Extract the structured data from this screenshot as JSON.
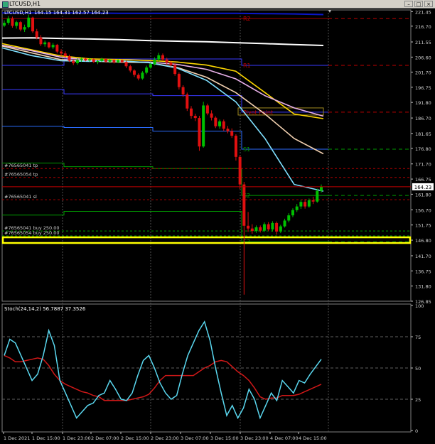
{
  "window": {
    "title": "LTCUSD,H1",
    "buttons": [
      "–",
      "□",
      "×"
    ]
  },
  "chart_header": {
    "symbol": "LTCUSD,H1",
    "ohlc": "164.15 164.31 162.57 164.23"
  },
  "colors": {
    "background": "#000000",
    "bull": "#00c000",
    "bear": "#e01010",
    "grid": "#404040",
    "current_price": "#c00000",
    "order_line": "#ffff00"
  },
  "chart_data": [
    {
      "type": "line",
      "title": "LTCUSD,H1",
      "subtitle": "164.15 164.31 162.57 164.23",
      "y_ticks": [
        221.45,
        216.7,
        211.55,
        206.6,
        201.7,
        196.75,
        191.8,
        186.7,
        181.65,
        176.8,
        171.7,
        166.75,
        161.8,
        156.7,
        151.75,
        146.8,
        141.7,
        136.75,
        131.8,
        126.85
      ],
      "ylim": [
        126.85,
        222.0
      ],
      "x_ticks": [
        "1 Dec 2021",
        "1 Dec 15:00",
        "1 Dec 23:00",
        "2 Dec 07:00",
        "2 Dec 15:00",
        "2 Dec 23:00",
        "3 Dec 07:00",
        "3 Dec 15:00",
        "3 Dec 23:00",
        "4 Dec 07:00",
        "4 Dec 15:00"
      ],
      "current_price": 164.23,
      "highlighted_price": 146.8,
      "candles": [
        [
          216.9,
          218.6,
          216.4,
          217.8
        ],
        [
          217.8,
          220.0,
          217.2,
          219.2
        ],
        [
          219.2,
          219.8,
          216.2,
          216.8
        ],
        [
          216.8,
          218.5,
          215.9,
          218.0
        ],
        [
          218.0,
          218.4,
          215.0,
          215.6
        ],
        [
          215.6,
          217.2,
          214.8,
          216.4
        ],
        [
          216.4,
          220.5,
          216.0,
          219.5
        ],
        [
          219.5,
          219.8,
          214.5,
          215.0
        ],
        [
          215.0,
          215.8,
          212.4,
          213.0
        ],
        [
          213.0,
          213.8,
          210.2,
          210.8
        ],
        [
          210.8,
          212.0,
          210.0,
          211.4
        ],
        [
          211.4,
          211.6,
          209.4,
          209.8
        ],
        [
          209.8,
          211.2,
          209.2,
          210.6
        ],
        [
          210.6,
          210.9,
          207.8,
          208.4
        ],
        [
          208.4,
          209.2,
          207.0,
          207.8
        ],
        [
          207.8,
          208.5,
          206.4,
          206.9
        ],
        [
          206.9,
          207.4,
          205.0,
          205.4
        ],
        [
          205.4,
          205.9,
          204.0,
          204.6
        ],
        [
          204.6,
          206.2,
          204.1,
          205.6
        ],
        [
          205.6,
          206.6,
          205.0,
          206.1
        ],
        [
          206.1,
          206.4,
          205.2,
          205.5
        ],
        [
          205.5,
          206.3,
          205.1,
          205.9
        ],
        [
          205.9,
          206.1,
          204.7,
          205.0
        ],
        [
          205.0,
          205.6,
          204.3,
          205.3
        ],
        [
          205.3,
          206.4,
          205.0,
          206.0
        ],
        [
          206.0,
          206.2,
          204.8,
          205.1
        ],
        [
          205.1,
          206.0,
          204.6,
          205.7
        ],
        [
          205.7,
          205.9,
          204.5,
          204.9
        ],
        [
          204.9,
          205.9,
          204.6,
          205.6
        ],
        [
          205.6,
          205.8,
          204.6,
          205.0
        ],
        [
          205.0,
          205.4,
          203.0,
          203.6
        ],
        [
          203.6,
          204.1,
          201.6,
          202.2
        ],
        [
          202.2,
          202.6,
          200.1,
          200.8
        ],
        [
          200.8,
          201.3,
          199.0,
          199.6
        ],
        [
          199.6,
          202.0,
          199.2,
          201.5
        ],
        [
          201.5,
          203.8,
          201.0,
          203.2
        ],
        [
          203.2,
          204.8,
          202.8,
          204.3
        ],
        [
          204.3,
          206.5,
          203.9,
          205.8
        ],
        [
          205.8,
          208.0,
          205.2,
          207.2
        ],
        [
          207.2,
          207.8,
          205.3,
          205.8
        ],
        [
          205.8,
          206.4,
          204.1,
          204.8
        ],
        [
          204.8,
          205.4,
          203.5,
          204.0
        ],
        [
          204.0,
          204.6,
          200.5,
          201.1
        ],
        [
          201.1,
          201.6,
          196.0,
          196.8
        ],
        [
          196.8,
          197.4,
          193.6,
          194.4
        ],
        [
          194.4,
          195.0,
          189.0,
          189.8
        ],
        [
          189.8,
          190.6,
          186.5,
          187.4
        ],
        [
          187.4,
          188.1,
          185.7,
          186.7
        ],
        [
          186.7,
          187.4,
          176.0,
          177.4
        ],
        [
          177.4,
          192.0,
          177.0,
          190.8
        ],
        [
          190.8,
          191.4,
          187.6,
          188.2
        ],
        [
          188.2,
          189.2,
          185.9,
          186.8
        ],
        [
          186.8,
          187.3,
          183.4,
          184.0
        ],
        [
          184.0,
          186.2,
          183.2,
          185.6
        ],
        [
          185.6,
          186.2,
          182.5,
          183.2
        ],
        [
          183.2,
          184.1,
          181.7,
          182.4
        ],
        [
          182.4,
          183.3,
          180.2,
          180.9
        ],
        [
          180.9,
          181.4,
          172.8,
          174.0
        ],
        [
          174.0,
          174.6,
          163.5,
          165.0
        ],
        [
          165.0,
          165.8,
          129.0,
          151.5
        ],
        [
          151.5,
          156.0,
          149.5,
          150.6
        ],
        [
          150.6,
          152.0,
          148.9,
          149.8
        ],
        [
          149.8,
          151.6,
          149.2,
          151.0
        ],
        [
          151.0,
          151.6,
          149.3,
          149.9
        ],
        [
          149.9,
          152.6,
          149.5,
          152.0
        ],
        [
          152.0,
          152.7,
          149.7,
          150.3
        ],
        [
          150.3,
          153.0,
          149.6,
          152.4
        ],
        [
          152.4,
          152.9,
          148.6,
          149.6
        ],
        [
          149.6,
          151.8,
          149.1,
          151.3
        ],
        [
          151.3,
          153.8,
          150.9,
          153.2
        ],
        [
          153.2,
          155.6,
          152.6,
          154.9
        ],
        [
          154.9,
          157.2,
          154.3,
          156.6
        ],
        [
          156.6,
          158.6,
          156.0,
          157.8
        ],
        [
          157.8,
          160.0,
          157.0,
          159.3
        ],
        [
          159.3,
          160.2,
          157.1,
          157.8
        ],
        [
          157.8,
          160.4,
          157.4,
          159.8
        ],
        [
          159.8,
          161.0,
          158.6,
          159.4
        ],
        [
          159.4,
          163.6,
          159.0,
          162.9
        ],
        [
          162.9,
          165.0,
          162.3,
          164.23
        ]
      ],
      "stochastic": {
        "label": "Stoch(24,14,2) 56.7887 37.3526",
        "ylim": [
          0,
          100
        ],
        "y_ticks": [
          100,
          75,
          50,
          25,
          0
        ],
        "main": [
          60,
          73,
          70,
          60,
          50,
          40,
          45,
          60,
          80,
          68,
          40,
          30,
          20,
          10,
          15,
          20,
          22,
          28,
          30,
          40,
          33,
          25,
          24,
          30,
          44,
          56,
          60,
          50,
          38,
          30,
          25,
          28,
          45,
          60,
          70,
          80,
          87,
          72,
          50,
          30,
          12,
          20,
          10,
          18,
          33,
          25,
          10,
          20,
          30,
          24,
          40,
          35,
          30,
          40,
          38,
          45,
          51,
          57
        ],
        "signal": [
          60,
          58,
          55,
          55,
          56,
          57,
          58,
          57,
          52,
          45,
          40,
          37,
          35,
          33,
          31,
          30,
          28,
          27,
          24,
          24,
          24,
          24,
          24,
          25,
          26,
          27,
          29,
          34,
          40,
          44,
          44,
          44,
          44,
          44,
          44,
          47,
          50,
          52,
          55,
          56,
          55,
          51,
          47,
          44,
          40,
          34,
          27,
          25,
          26,
          26,
          28,
          28,
          28,
          29,
          31,
          33,
          35,
          37
        ]
      },
      "moving_averages": [
        {
          "color": "#0a16c8",
          "values": [
            221.0,
            221.0,
            221.0,
            221.0,
            220.9,
            220.9,
            220.9,
            220.9,
            220.9,
            220.8,
            220.7,
            220.5
          ]
        },
        {
          "color": "#ffffff",
          "values": [
            212.8,
            212.9,
            212.7,
            212.5,
            212.3,
            212.0,
            211.8,
            211.6,
            211.3,
            211.0,
            210.7,
            210.4
          ]
        },
        {
          "color": "#ffd800",
          "values": [
            211.0,
            209.0,
            207.0,
            206.0,
            205.8,
            205.5,
            205.0,
            204.0,
            202.0,
            195.0,
            188.0,
            186.5
          ]
        },
        {
          "color": "#e8b0e8",
          "values": [
            210.5,
            208.7,
            206.6,
            205.6,
            205.0,
            205.0,
            204.2,
            202.6,
            199.5,
            194.0,
            190.0,
            187.3
          ]
        },
        {
          "color": "#f2d0b0",
          "values": [
            210.2,
            208.0,
            205.8,
            205.3,
            205.0,
            204.8,
            203.2,
            200.0,
            195.0,
            188.0,
            180.0,
            175.0
          ]
        },
        {
          "color": "#7fe0ff",
          "values": [
            209.6,
            207.1,
            205.4,
            205.2,
            205.4,
            204.8,
            203.0,
            199.0,
            192.0,
            180.0,
            165.0,
            162.8
          ]
        }
      ],
      "levels": [
        {
          "label": "R2",
          "value": 219.2,
          "color": "#c00000"
        },
        {
          "label": "R1",
          "value": 203.9,
          "color": "#c00000"
        },
        {
          "label": "Pivot Point",
          "value": 188.6,
          "color": "#c00000"
        },
        {
          "label": "S1",
          "value": 176.5,
          "color": "#009a00"
        },
        {
          "label": "S2",
          "value": 161.4,
          "color": "#009a00"
        },
        {
          "label": "S3",
          "value": 146.3,
          "color": "#009a00"
        }
      ],
      "trade_lines": [
        {
          "label": "#76565041 tp",
          "value": 170.2,
          "color": "#b00000"
        },
        {
          "label": "#76565054 tp",
          "value": 167.3,
          "color": "#b00000"
        },
        {
          "label": "#76565041 sl",
          "value": 160.0,
          "color": "#b00000"
        },
        {
          "label": "#76565041 buy 250.00",
          "value": 149.8,
          "color": "#00a000"
        },
        {
          "label": "#76565054 buy 250.00",
          "value": 148.2,
          "color": "#00a000"
        }
      ]
    }
  ]
}
